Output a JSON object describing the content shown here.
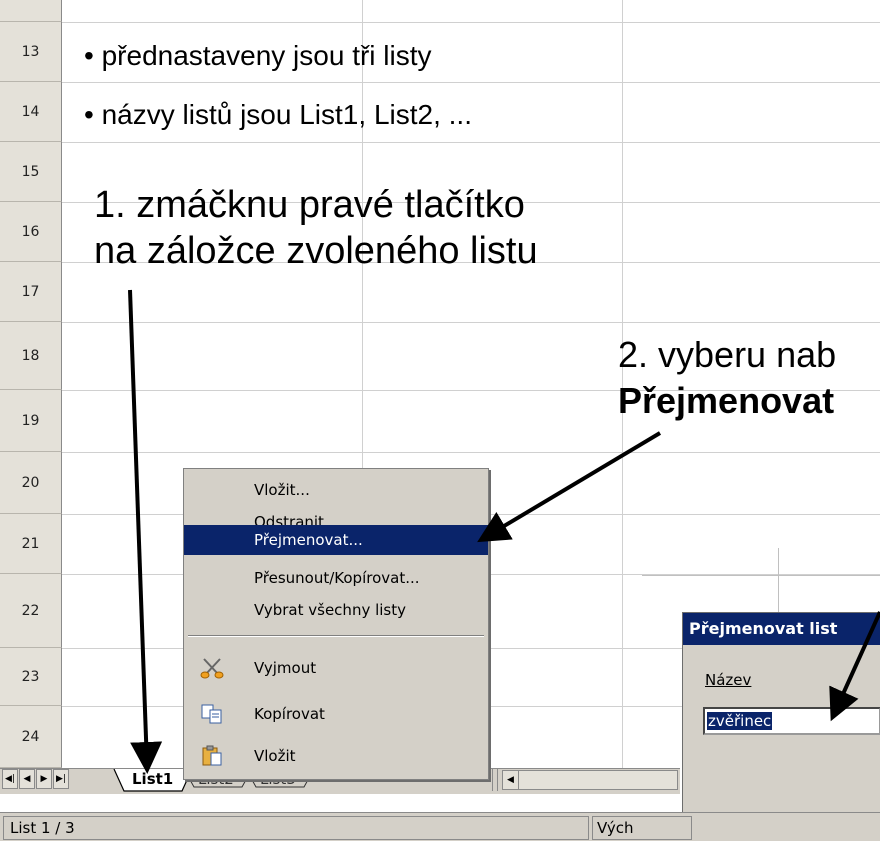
{
  "rows": [
    "13",
    "14",
    "15",
    "16",
    "17",
    "18",
    "19",
    "20",
    "21",
    "22",
    "23",
    "24"
  ],
  "bullets": [
    "přednastaveny jsou tři listy",
    "názvy listů jsou List1, List2, ..."
  ],
  "bullet_char": "•",
  "annotation1": {
    "line1": "1. zmáčknu pravé tlačítko",
    "line2": "na záložce zvoleného listu"
  },
  "annotation2": {
    "line1": "2. vyberu nab",
    "line2": "Přejmenovat"
  },
  "context_menu": {
    "items": [
      {
        "label": "Vložit...",
        "selected": false
      },
      {
        "label": "Odstranit...",
        "selected": false
      },
      {
        "label": "Přejmenovat...",
        "selected": true
      },
      {
        "label": "Přesunout/Kopírovat...",
        "selected": false
      },
      {
        "label": "Vybrat všechny listy",
        "selected": false
      }
    ],
    "clipboard_items": [
      {
        "label": "Vyjmout",
        "icon": "scissors-icon"
      },
      {
        "label": "Kopírovat",
        "icon": "copy-icon"
      },
      {
        "label": "Vložit",
        "icon": "paste-icon"
      }
    ],
    "selected_color": "#0a246a"
  },
  "tabs": [
    "List1",
    "List2",
    "List3"
  ],
  "nav_buttons": [
    "first-sheet",
    "prev-sheet",
    "next-sheet",
    "last-sheet"
  ],
  "status": {
    "sheet": "List 1 / 3",
    "style": "Vých"
  },
  "dialog": {
    "title": "Přejmenovat list",
    "label": "Název",
    "value": "zvěřinec",
    "title_color": "#0a246a"
  }
}
